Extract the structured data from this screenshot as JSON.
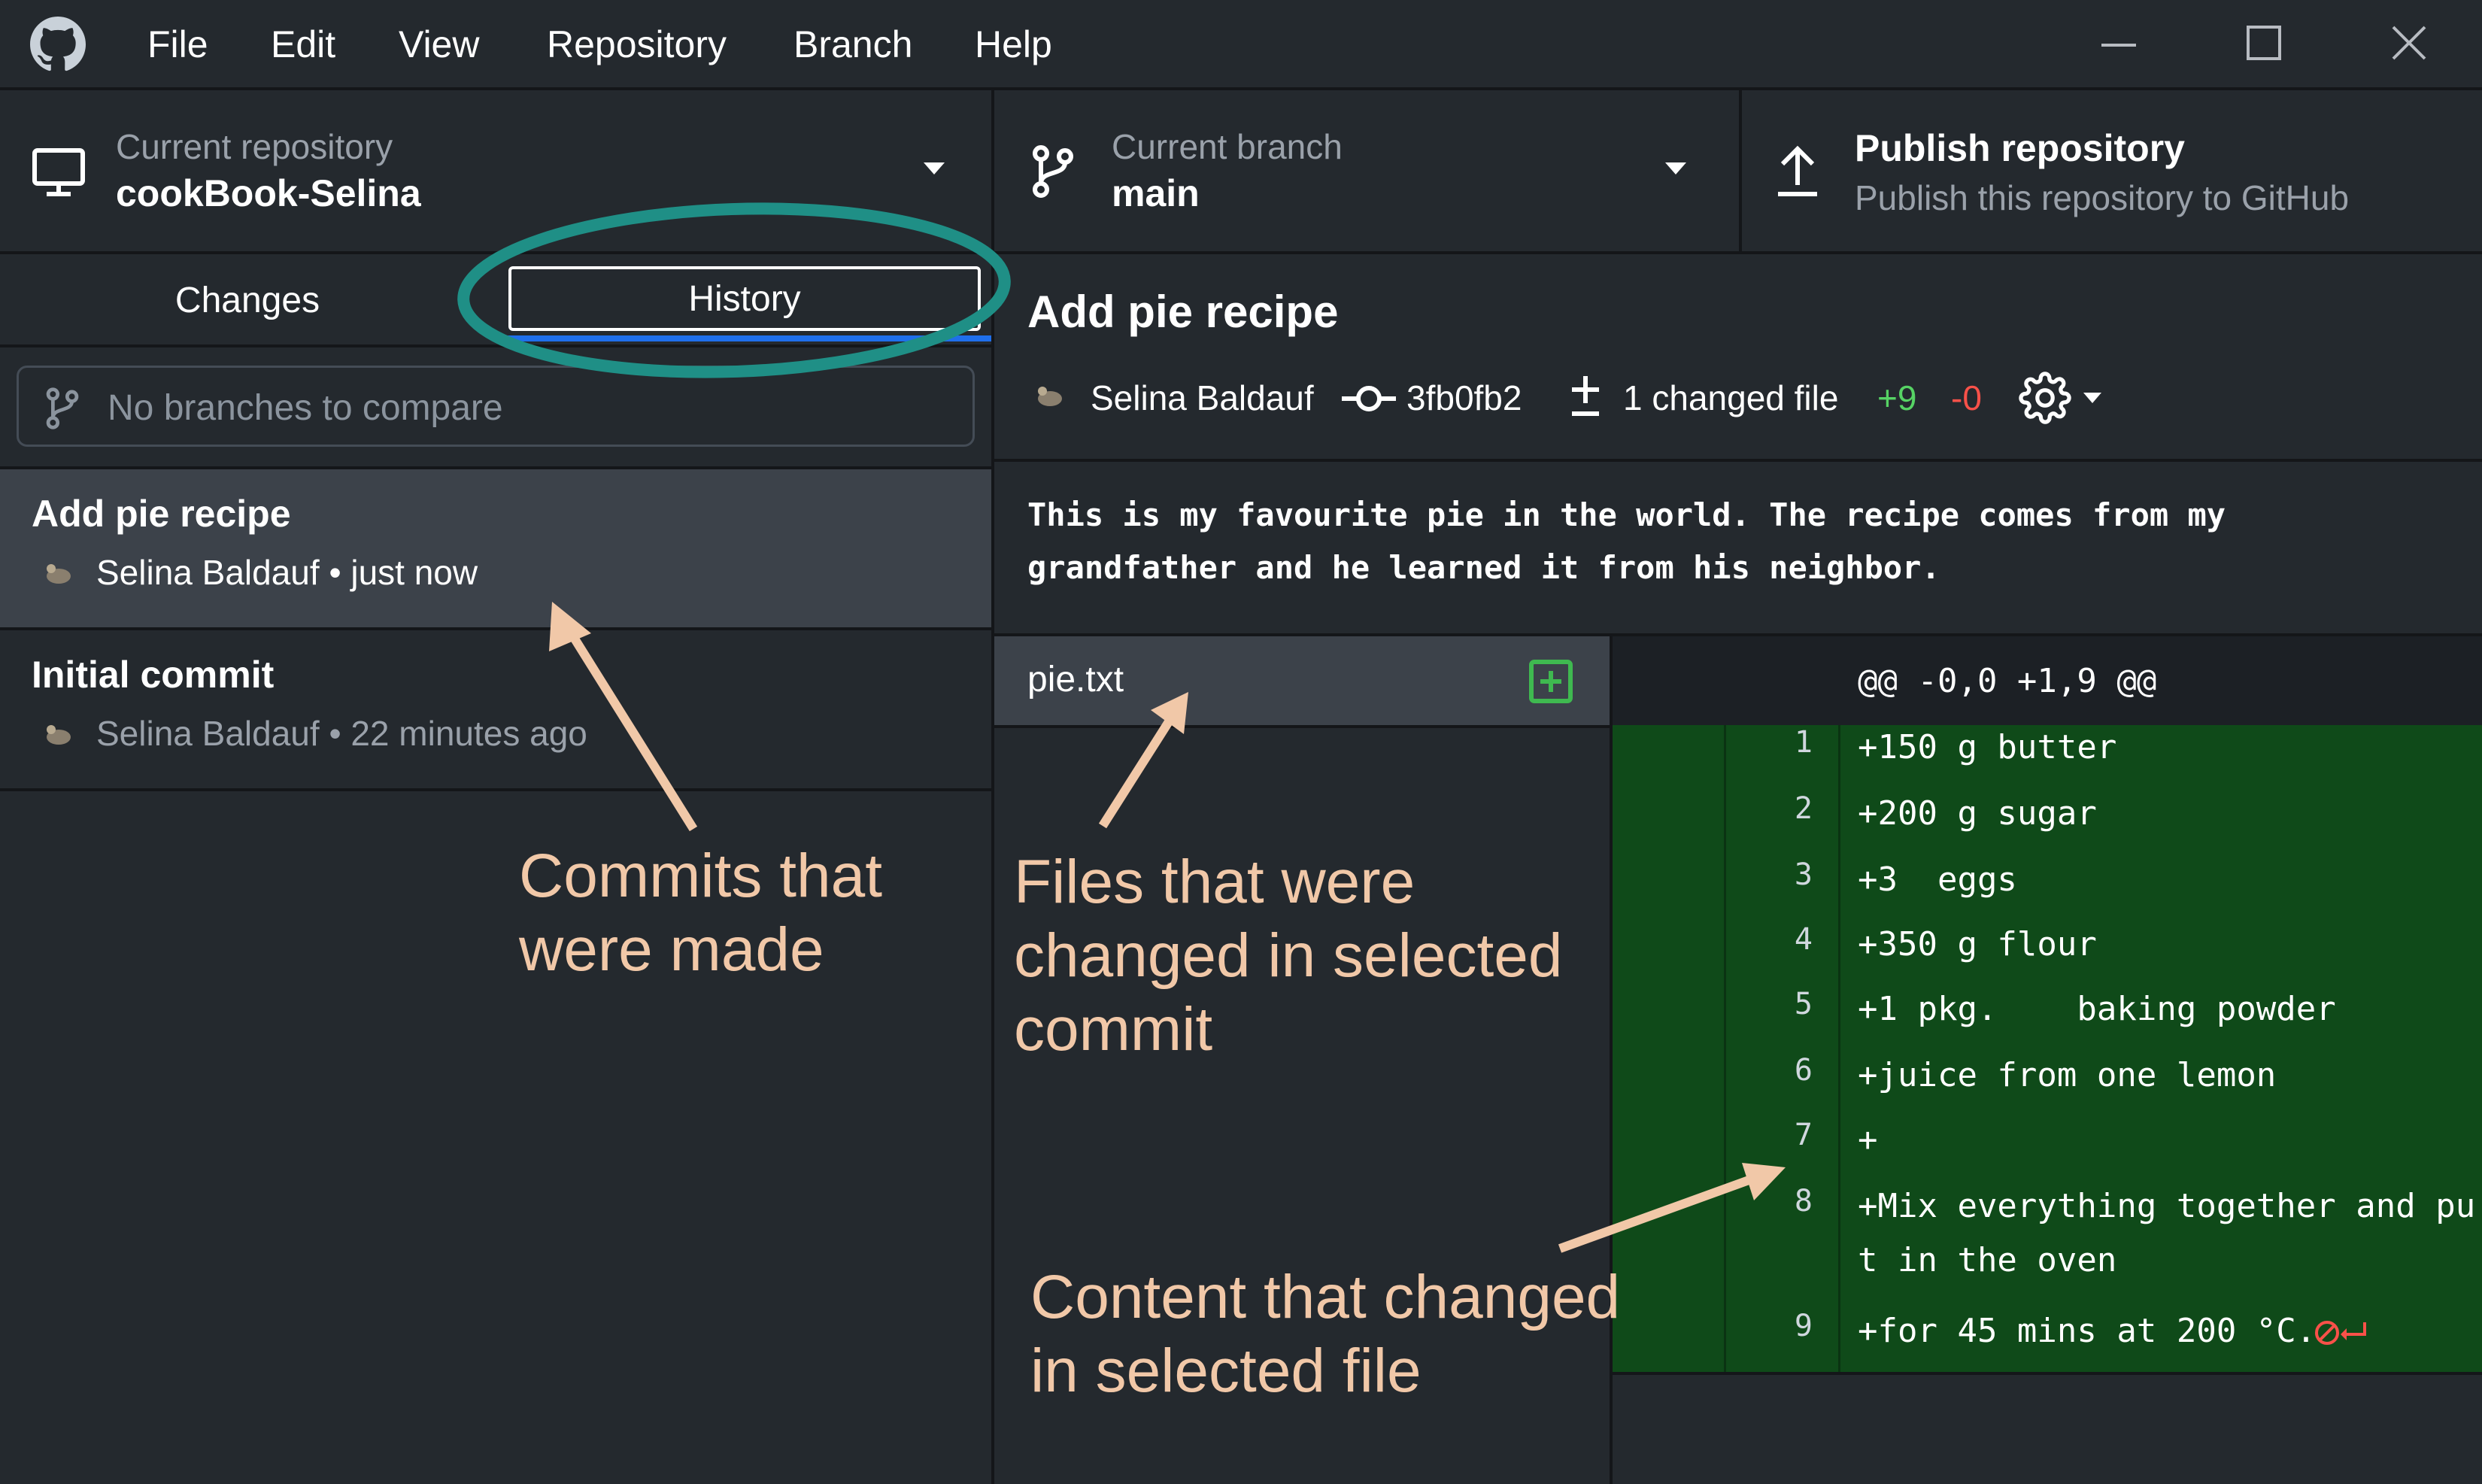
{
  "menubar": {
    "items": [
      "File",
      "Edit",
      "View",
      "Repository",
      "Branch",
      "Help"
    ]
  },
  "toolbar": {
    "repo_label": "Current repository",
    "repo_name": "cookBook-Selina",
    "branch_label": "Current branch",
    "branch_name": "main",
    "publish_title": "Publish repository",
    "publish_subtitle": "Publish this repository to GitHub"
  },
  "sidebar": {
    "tabs": [
      "Changes",
      "History"
    ],
    "active_tab": "History",
    "compare_placeholder": "No branches to compare",
    "commits": [
      {
        "title": "Add pie recipe",
        "author": "Selina Baldauf",
        "time": "just now",
        "selected": true
      },
      {
        "title": "Initial commit",
        "author": "Selina Baldauf",
        "time": "22 minutes ago",
        "selected": false
      }
    ]
  },
  "commit_detail": {
    "title": "Add pie recipe",
    "author": "Selina Baldauf",
    "sha": "3fb0fb2",
    "changed_files": "1 changed file",
    "additions": "+9",
    "deletions": "-0",
    "description_line1": "This is my favourite pie in the world. The recipe comes from my",
    "description_line2": "grandfather and he learned it from his neighbor."
  },
  "files": [
    {
      "name": "pie.txt",
      "status": "added"
    }
  ],
  "diff": {
    "hunk_header": "@@ -0,0 +1,9 @@",
    "lines": [
      {
        "num": "1",
        "text": "+150 g butter"
      },
      {
        "num": "2",
        "text": "+200 g sugar"
      },
      {
        "num": "3",
        "text": "+3  eggs"
      },
      {
        "num": "4",
        "text": "+350 g flour"
      },
      {
        "num": "5",
        "text": "+1 pkg.    baking powder"
      },
      {
        "num": "6",
        "text": "+juice from one lemon"
      },
      {
        "num": "7",
        "text": "+"
      },
      {
        "num": "8",
        "text": "+Mix everything together and pu"
      },
      {
        "num": "",
        "text": "t in the oven"
      },
      {
        "num": "9",
        "text": "+for 45 mins at 200 °C."
      }
    ]
  },
  "annotations": {
    "commits_line1": "Commits that",
    "commits_line2": "were made",
    "files_line1": "Files that were",
    "files_line2": "changed in selected",
    "files_line3": "commit",
    "content_line1": "Content that changed",
    "content_line2": "in selected file"
  },
  "colors": {
    "background": "#24292e",
    "selected_row": "#3c424a",
    "diff_added": "#0f4a19",
    "additions": "#56d364",
    "deletions": "#f85149",
    "highlight_ring": "#1f8f86",
    "annotation": "#f1c8a8",
    "tab_underline": "#1f6feb"
  },
  "icons": {
    "app": "github-logo-icon",
    "repo": "computer-icon",
    "branch": "git-branch-icon",
    "publish": "upload-icon",
    "commit": "git-commit-icon",
    "diff": "diff-icon",
    "settings": "gear-icon",
    "file_added": "plus-square-icon",
    "no_newline": "no-newline-icon"
  }
}
